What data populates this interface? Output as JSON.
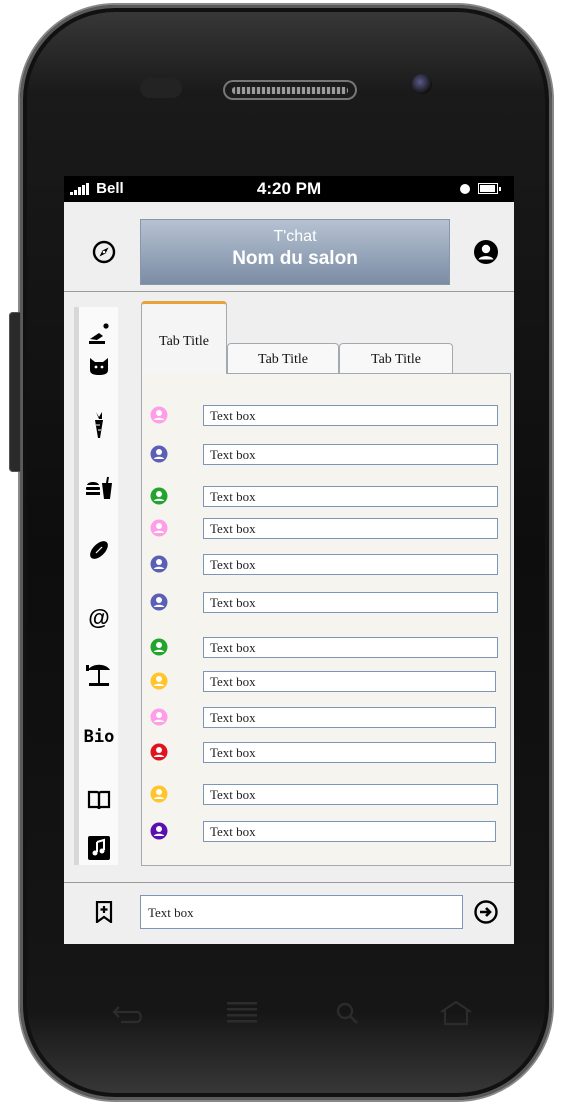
{
  "status_bar": {
    "carrier": "Bell",
    "time": "4:20 PM"
  },
  "header": {
    "subtitle": "T'chat",
    "room_name": "Nom du salon",
    "left_icon": "compass-icon",
    "right_icon": "user-account-icon"
  },
  "categories": [
    {
      "icon": "bowling-icon",
      "label": ""
    },
    {
      "icon": "cat-icon",
      "label": ""
    },
    {
      "icon": "carrot-icon",
      "label": ""
    },
    {
      "icon": "fast-food-icon",
      "label": ""
    },
    {
      "icon": "rugby-ball-icon",
      "label": ""
    },
    {
      "icon": "at-sign-icon",
      "label": "@"
    },
    {
      "icon": "beach-umbrella-icon",
      "label": ""
    },
    {
      "icon": "bio-icon",
      "label": "Bio"
    },
    {
      "icon": "book-icon",
      "label": ""
    },
    {
      "icon": "music-note-icon",
      "label": ""
    }
  ],
  "tabs": [
    {
      "label": "Tab Title",
      "active": true
    },
    {
      "label": "Tab Title",
      "active": false
    },
    {
      "label": "Tab Title",
      "active": false
    }
  ],
  "messages": [
    {
      "user_color": "#ff9ee8",
      "text": "Text box"
    },
    {
      "user_color": "#5b5fb5",
      "text": "Text box"
    },
    {
      "user_color": "#22a52c",
      "text": "Text box"
    },
    {
      "user_color": "#ff9ee8",
      "text": "Text box"
    },
    {
      "user_color": "#5b5fb5",
      "text": "Text box"
    },
    {
      "user_color": "#5b5fb5",
      "text": "Text box"
    },
    {
      "user_color": "#22a52c",
      "text": "Text box"
    },
    {
      "user_color": "#ffc52a",
      "text": "Text box"
    },
    {
      "user_color": "#ff9ee8",
      "text": "Text box"
    },
    {
      "user_color": "#e0141e",
      "text": "Text box"
    },
    {
      "user_color": "#ffc52a",
      "text": "Text box"
    },
    {
      "user_color": "#5a0fb0",
      "text": "Text box"
    }
  ],
  "composer": {
    "text": "Text box",
    "bookmark_icon": "add-bookmark-icon",
    "send_icon": "send-arrow-icon"
  },
  "nav_keys": [
    "back-icon",
    "menu-icon",
    "search-icon",
    "home-icon"
  ]
}
